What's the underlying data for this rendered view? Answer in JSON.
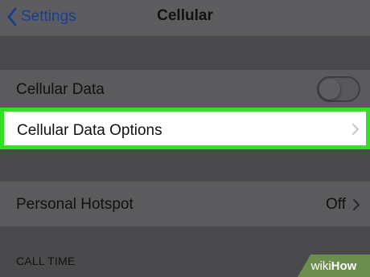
{
  "navbar": {
    "back_label": "Settings",
    "title": "Cellular"
  },
  "rows": {
    "cellular_data": {
      "label": "Cellular Data",
      "toggle_on": false
    },
    "cellular_data_options": {
      "label": "Cellular Data Options"
    },
    "personal_hotspot": {
      "label": "Personal Hotspot",
      "value": "Off"
    }
  },
  "section_header": "CALL TIME",
  "watermark": {
    "wiki": "wiki",
    "how": "How"
  },
  "colors": {
    "highlight_border": "#34e024",
    "back_link": "#1a3f8c",
    "watermark_bg": "#6b8e4e"
  },
  "icons": [
    "chevron-left-icon",
    "chevron-right-icon"
  ]
}
